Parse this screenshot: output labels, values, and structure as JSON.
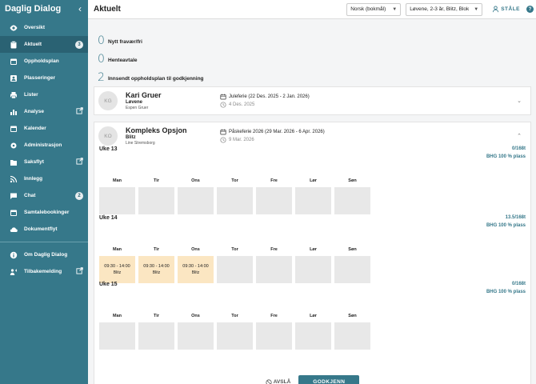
{
  "app": {
    "title": "Daglig Dialog",
    "collapse_icon": "chevron-left-icon"
  },
  "sidebar": {
    "items": [
      {
        "label": "Oversikt",
        "icon": "eye-icon"
      },
      {
        "label": "Aktuelt",
        "icon": "clipboard-icon",
        "badge": "3",
        "active": true
      },
      {
        "label": "Oppholdsplan",
        "icon": "calendar-icon"
      },
      {
        "label": "Plasseringer",
        "icon": "person-icon"
      },
      {
        "label": "Lister",
        "icon": "printer-icon"
      },
      {
        "label": "Analyse",
        "icon": "bar-chart-icon",
        "external": true
      },
      {
        "label": "Kalender",
        "icon": "calendar-icon"
      },
      {
        "label": "Administrasjon",
        "icon": "gear-icon"
      },
      {
        "label": "Saksflyt",
        "icon": "folder-icon",
        "external": true
      },
      {
        "label": "Innlegg",
        "icon": "rss-icon"
      },
      {
        "label": "Chat",
        "icon": "chat-icon",
        "badge": "2"
      },
      {
        "label": "Samtalebookinger",
        "icon": "calendar-icon"
      },
      {
        "label": "Dokumentflyt",
        "icon": "cloud-icon"
      }
    ],
    "bottom_items": [
      {
        "label": "Om Daglig Dialog",
        "icon": "info-icon"
      },
      {
        "label": "Tilbakemelding",
        "icon": "feedback-icon",
        "external": true
      }
    ]
  },
  "topbar": {
    "title": "Aktuelt",
    "language_select": "Norsk (bokmål)",
    "group_select": "Løvene, 2-3 år, Blitz, Bloki",
    "staff_button": "STÅLE",
    "help_label": "?"
  },
  "summary": [
    {
      "count": "0",
      "label": "Nytt fravær/fri"
    },
    {
      "count": "0",
      "label": "Henteavtale"
    },
    {
      "count": "2",
      "label": "Innsendt oppholdsplan til godkjenning"
    }
  ],
  "requests": [
    {
      "initials": "KG",
      "name": "Kari Gruer",
      "group": "Løvene",
      "staff": "Espen Gruer",
      "period": "Juleferie (22 Des. 2025 - 2 Jan. 2026)",
      "submitted": "4 Des. 2025",
      "expanded": false
    },
    {
      "initials": "KO",
      "name": "Kompleks Opsjon",
      "group": "Blitz",
      "staff": "Line Stremsborg",
      "period": "Påskeferie 2026 (29 Mar. 2026 - 6 Apr. 2026)",
      "submitted": "9 Mar. 2026",
      "expanded": true,
      "weeks": [
        {
          "title": "Uke 13",
          "hours": "0/168t",
          "plan": "BHG 100 % plass",
          "days": [
            {
              "name": "Man"
            },
            {
              "name": "Tir"
            },
            {
              "name": "Ons"
            },
            {
              "name": "Tor"
            },
            {
              "name": "Fre"
            },
            {
              "name": "Lør"
            },
            {
              "name": "Søn"
            }
          ]
        },
        {
          "title": "Uke 14",
          "hours": "13.5/168t",
          "plan": "BHG 100 % plass",
          "days": [
            {
              "name": "Man",
              "time": "09:30 - 14:00",
              "group": "Blitz"
            },
            {
              "name": "Tir",
              "time": "09:30 - 14:00",
              "group": "Blitz"
            },
            {
              "name": "Ons",
              "time": "09:30 - 14:00",
              "group": "Blitz"
            },
            {
              "name": "Tor"
            },
            {
              "name": "Fre"
            },
            {
              "name": "Lør"
            },
            {
              "name": "Søn"
            }
          ]
        },
        {
          "title": "Uke 15",
          "hours": "0/168t",
          "plan": "BHG 100 % plass",
          "days": [
            {
              "name": "Man"
            },
            {
              "name": "Tir"
            },
            {
              "name": "Ons"
            },
            {
              "name": "Tor"
            },
            {
              "name": "Fre"
            },
            {
              "name": "Lør"
            },
            {
              "name": "Søn"
            }
          ]
        }
      ],
      "reject_label": "AVSLÅ",
      "approve_label": "GODKJENN"
    }
  ],
  "colors": {
    "brand": "#36788a",
    "brand_dark": "#2a6273",
    "booked": "#fbe6c2",
    "empty_day": "#e8e8e8"
  }
}
